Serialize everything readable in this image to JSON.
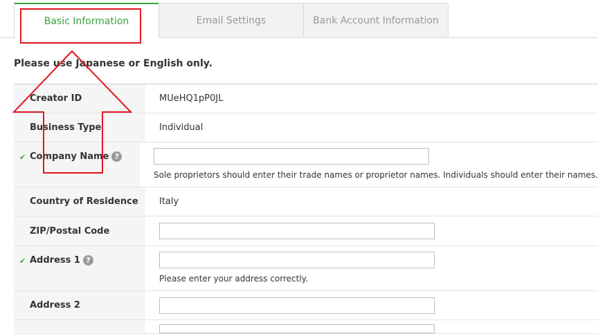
{
  "tabs": {
    "basic": "Basic Information",
    "email": "Email Settings",
    "bank": "Bank Account Information"
  },
  "notice": "Please use Japanese or English only.",
  "fields": {
    "creator_id": {
      "label": "Creator ID",
      "value": "MUeHQ1pP0JL"
    },
    "business_type": {
      "label": "Business Type",
      "value": "Individual"
    },
    "company_name": {
      "label": "Company Name",
      "value": "",
      "hint": "Sole proprietors should enter their trade names or proprietor names. Individuals should enter their names."
    },
    "country": {
      "label": "Country of Residence",
      "value": "Italy"
    },
    "zip": {
      "label": "ZIP/Postal Code",
      "value": ""
    },
    "address1": {
      "label": "Address 1",
      "value": "",
      "hint": "Please enter your address correctly."
    },
    "address2": {
      "label": "Address 2",
      "value": ""
    }
  },
  "icons": {
    "check": "✔",
    "help": "?"
  },
  "colors": {
    "accent": "#37a43b",
    "annotation": "#e0161f"
  }
}
